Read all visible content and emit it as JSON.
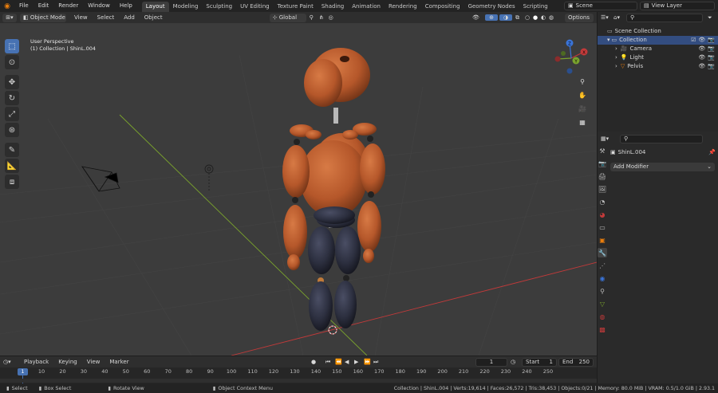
{
  "topbar": {
    "menus": [
      "File",
      "Edit",
      "Render",
      "Window",
      "Help"
    ],
    "workspaces": [
      "Layout",
      "Modeling",
      "Sculpting",
      "UV Editing",
      "Texture Paint",
      "Shading",
      "Animation",
      "Rendering",
      "Compositing",
      "Geometry Nodes",
      "Scripting"
    ],
    "active_workspace": "Layout",
    "scene": "Scene",
    "view_layer": "View Layer"
  },
  "viewport_header": {
    "mode": "Object Mode",
    "menus": [
      "View",
      "Select",
      "Add",
      "Object"
    ],
    "orientation": "Global",
    "options_label": "Options"
  },
  "viewport": {
    "perspective_label": "User Perspective",
    "collection_label": "(1) Collection | ShinL.004",
    "gizmo_axes": [
      "X",
      "Y",
      "Z"
    ]
  },
  "outliner": {
    "search_placeholder": "",
    "scene_collection": "Scene Collection",
    "collection": "Collection",
    "items": [
      {
        "label": "Camera",
        "icon": "camera-icon"
      },
      {
        "label": "Light",
        "icon": "light-icon"
      },
      {
        "label": "Pelvis",
        "icon": "mesh-icon"
      }
    ]
  },
  "properties": {
    "object_name": "ShinL.004",
    "add_modifier": "Add Modifier"
  },
  "timeline_header": {
    "menus": [
      "Playback",
      "Keying",
      "View",
      "Marker"
    ],
    "current_frame": "1",
    "start_label": "Start",
    "start_value": "1",
    "end_label": "End",
    "end_value": "250"
  },
  "timeline": {
    "current": "1",
    "ticks": [
      "10",
      "20",
      "30",
      "40",
      "50",
      "60",
      "70",
      "80",
      "90",
      "100",
      "110",
      "120",
      "130",
      "140",
      "150",
      "160",
      "170",
      "180",
      "190",
      "200",
      "210",
      "220",
      "230",
      "240",
      "250"
    ]
  },
  "statusbar": {
    "select": "Select",
    "box_select": "Box Select",
    "rotate_view": "Rotate View",
    "context_menu": "Object Context Menu",
    "stats": "Collection | ShinL.004 | Verts:19,614 | Faces:26,572 | Tris:38,453 | Objects:0/21 | Memory: 80.0 MiB | VRAM: 0.5/1.0 GiB | 2.93.1"
  },
  "colors": {
    "accent": "#4772b3",
    "body": "#b5572a",
    "dark_part": "#2c2f3f",
    "x_axis": "#c23a3a",
    "y_axis": "#7aa32d"
  }
}
